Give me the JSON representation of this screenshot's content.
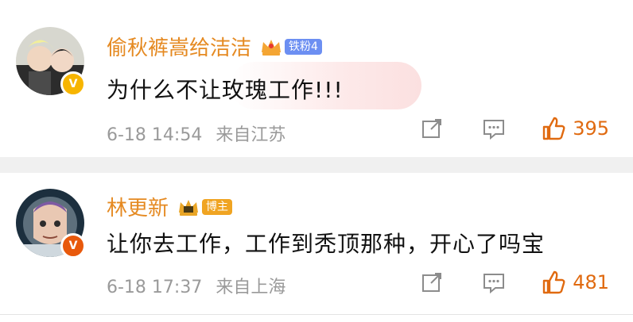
{
  "comments": [
    {
      "name": "偷秋裤嵩给洁洁",
      "badge": "铁粉4",
      "text": "为什么不让玫瑰工作!!!",
      "time": "6-18 14:54",
      "location": "来自江苏",
      "likes": "395"
    },
    {
      "name": "林更新",
      "badge": "博主",
      "text": "让你去工作，工作到秃顶那种，开心了吗宝",
      "time": "6-18 17:37",
      "location": "来自上海",
      "likes": "481"
    }
  ],
  "colors": {
    "username": "#e58a22",
    "like": "#e06a10",
    "meta": "#9a9a9a",
    "fan_badge": "#6c8ff2",
    "host_badge": "#f0a422"
  },
  "icons": [
    "share-icon",
    "reply-icon",
    "thumbs-up-icon",
    "crown-icon",
    "verified-badge-icon"
  ]
}
